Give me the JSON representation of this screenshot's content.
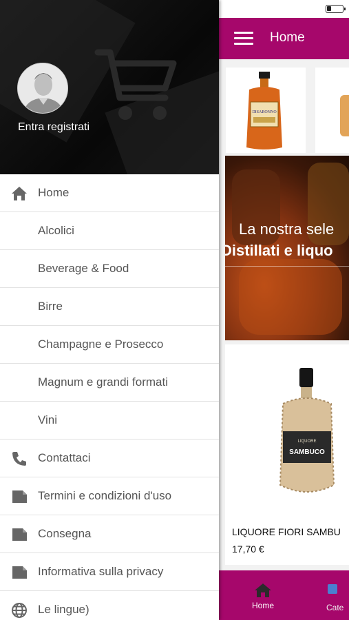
{
  "header": {
    "title": "Home",
    "menu_icon": "hamburger-icon"
  },
  "drawer": {
    "login_label": "Entra registrati",
    "avatar_icon": "user-avatar-icon",
    "watermark_icon": "shopping-cart-icon",
    "items": [
      {
        "label": "Home",
        "icon": "home-icon"
      },
      {
        "label": "Alcolici",
        "icon": ""
      },
      {
        "label": "Beverage & Food",
        "icon": ""
      },
      {
        "label": "Birre",
        "icon": ""
      },
      {
        "label": "Champagne e Prosecco",
        "icon": ""
      },
      {
        "label": "Magnum e grandi formati",
        "icon": ""
      },
      {
        "label": "Vini",
        "icon": ""
      },
      {
        "label": "Contattaci",
        "icon": "phone-icon"
      },
      {
        "label": "Termini e condizioni d'uso",
        "icon": "document-icon"
      },
      {
        "label": "Consegna",
        "icon": "document-icon"
      },
      {
        "label": "Informativa sulla privacy",
        "icon": "document-icon"
      },
      {
        "label": "Le lingue)",
        "icon": "globe-icon"
      }
    ]
  },
  "banner": {
    "line1": "La nostra sele",
    "line2": "Distillati e liquo"
  },
  "product": {
    "name": "LIQUORE FIORI SAMBU",
    "price": "17,70 €",
    "bottle_label": "SAMBUCO",
    "bottle_sublabel": "LIQUORE"
  },
  "featured_bottle_label": "DISARONNO",
  "bottom_nav": {
    "home_label": "Home",
    "categories_label": "Cate"
  },
  "colors": {
    "brand": "#a6076b",
    "drawer_header": "#0c0c0c",
    "menu_text": "#555555",
    "icon_gray": "#666666"
  }
}
